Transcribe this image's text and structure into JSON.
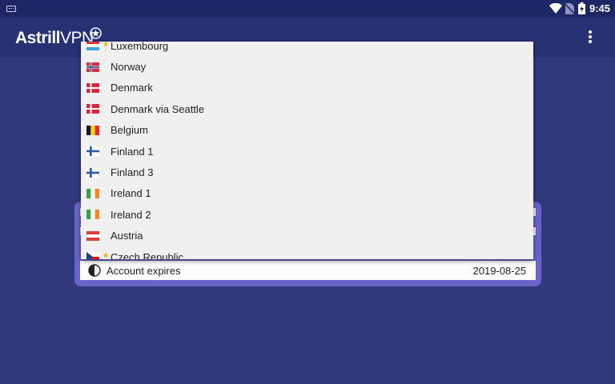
{
  "status_bar": {
    "time": "9:45"
  },
  "app_bar": {
    "logo_bold": "Astrill",
    "logo_light": "VPN"
  },
  "account": {
    "expires_label": "Account expires",
    "expires_value": "2019-08-25"
  },
  "server_list": [
    {
      "label": "Luxembourg",
      "flag": "luxembourg-flag",
      "starred": true
    },
    {
      "label": "Norway",
      "flag": "norway-flag",
      "starred": false
    },
    {
      "label": "Denmark",
      "flag": "denmark-flag",
      "starred": false
    },
    {
      "label": "Denmark via Seattle",
      "flag": "denmark-flag",
      "starred": false
    },
    {
      "label": "Belgium",
      "flag": "belgium-flag",
      "starred": false
    },
    {
      "label": "Finland 1",
      "flag": "finland-flag",
      "starred": false
    },
    {
      "label": "Finland 3",
      "flag": "finland-flag",
      "starred": false
    },
    {
      "label": "Ireland 1",
      "flag": "ireland-flag",
      "starred": false
    },
    {
      "label": "Ireland 2",
      "flag": "ireland-flag",
      "starred": false
    },
    {
      "label": "Austria",
      "flag": "austria-flag",
      "starred": false
    },
    {
      "label": "Czech Republic",
      "flag": "czech-flag",
      "starred": true
    }
  ],
  "colors": {
    "background": "#2f3a7c",
    "app_bar": "#273275",
    "status_bar": "#1e2766",
    "card": "#6a63c9",
    "dropdown": "#f0f0f0",
    "star": "#f2b632"
  }
}
